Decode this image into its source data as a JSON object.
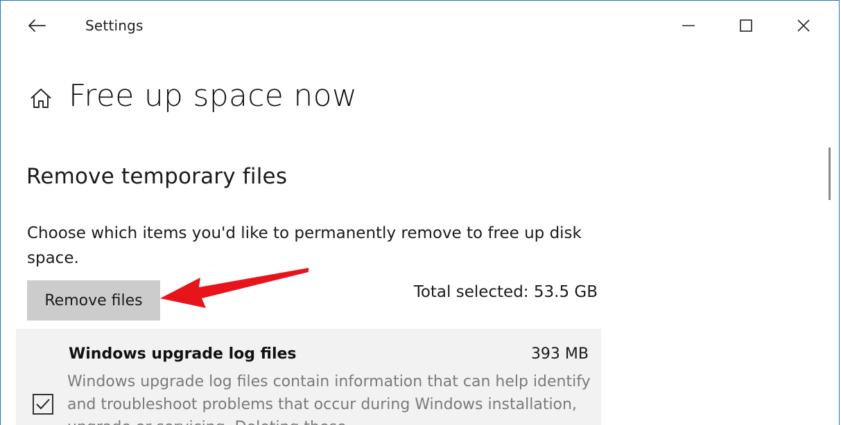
{
  "window": {
    "app_title": "Settings",
    "accent_color": "#1a73c7"
  },
  "icons": {
    "back": "back-arrow-icon",
    "minimize": "minimize-icon",
    "maximize": "maximize-icon",
    "close": "close-icon",
    "home": "home-icon",
    "checkbox": "checkmark-icon"
  },
  "page": {
    "title": "Free up space now"
  },
  "temp_files": {
    "section_title": "Remove temporary files",
    "description": "Choose which items you'd like to permanently remove to free up disk space.",
    "remove_button_label": "Remove files",
    "total_selected": "Total selected: 53.5 GB",
    "annotation_arrow_color": "#e8141b",
    "items": [
      {
        "name": "Windows upgrade log files",
        "size": "393 MB",
        "checked": true,
        "description": "Windows upgrade log files contain information that can help identify and troubleshoot problems that occur during Windows installation, upgrade or servicing. Deleting these"
      }
    ]
  }
}
